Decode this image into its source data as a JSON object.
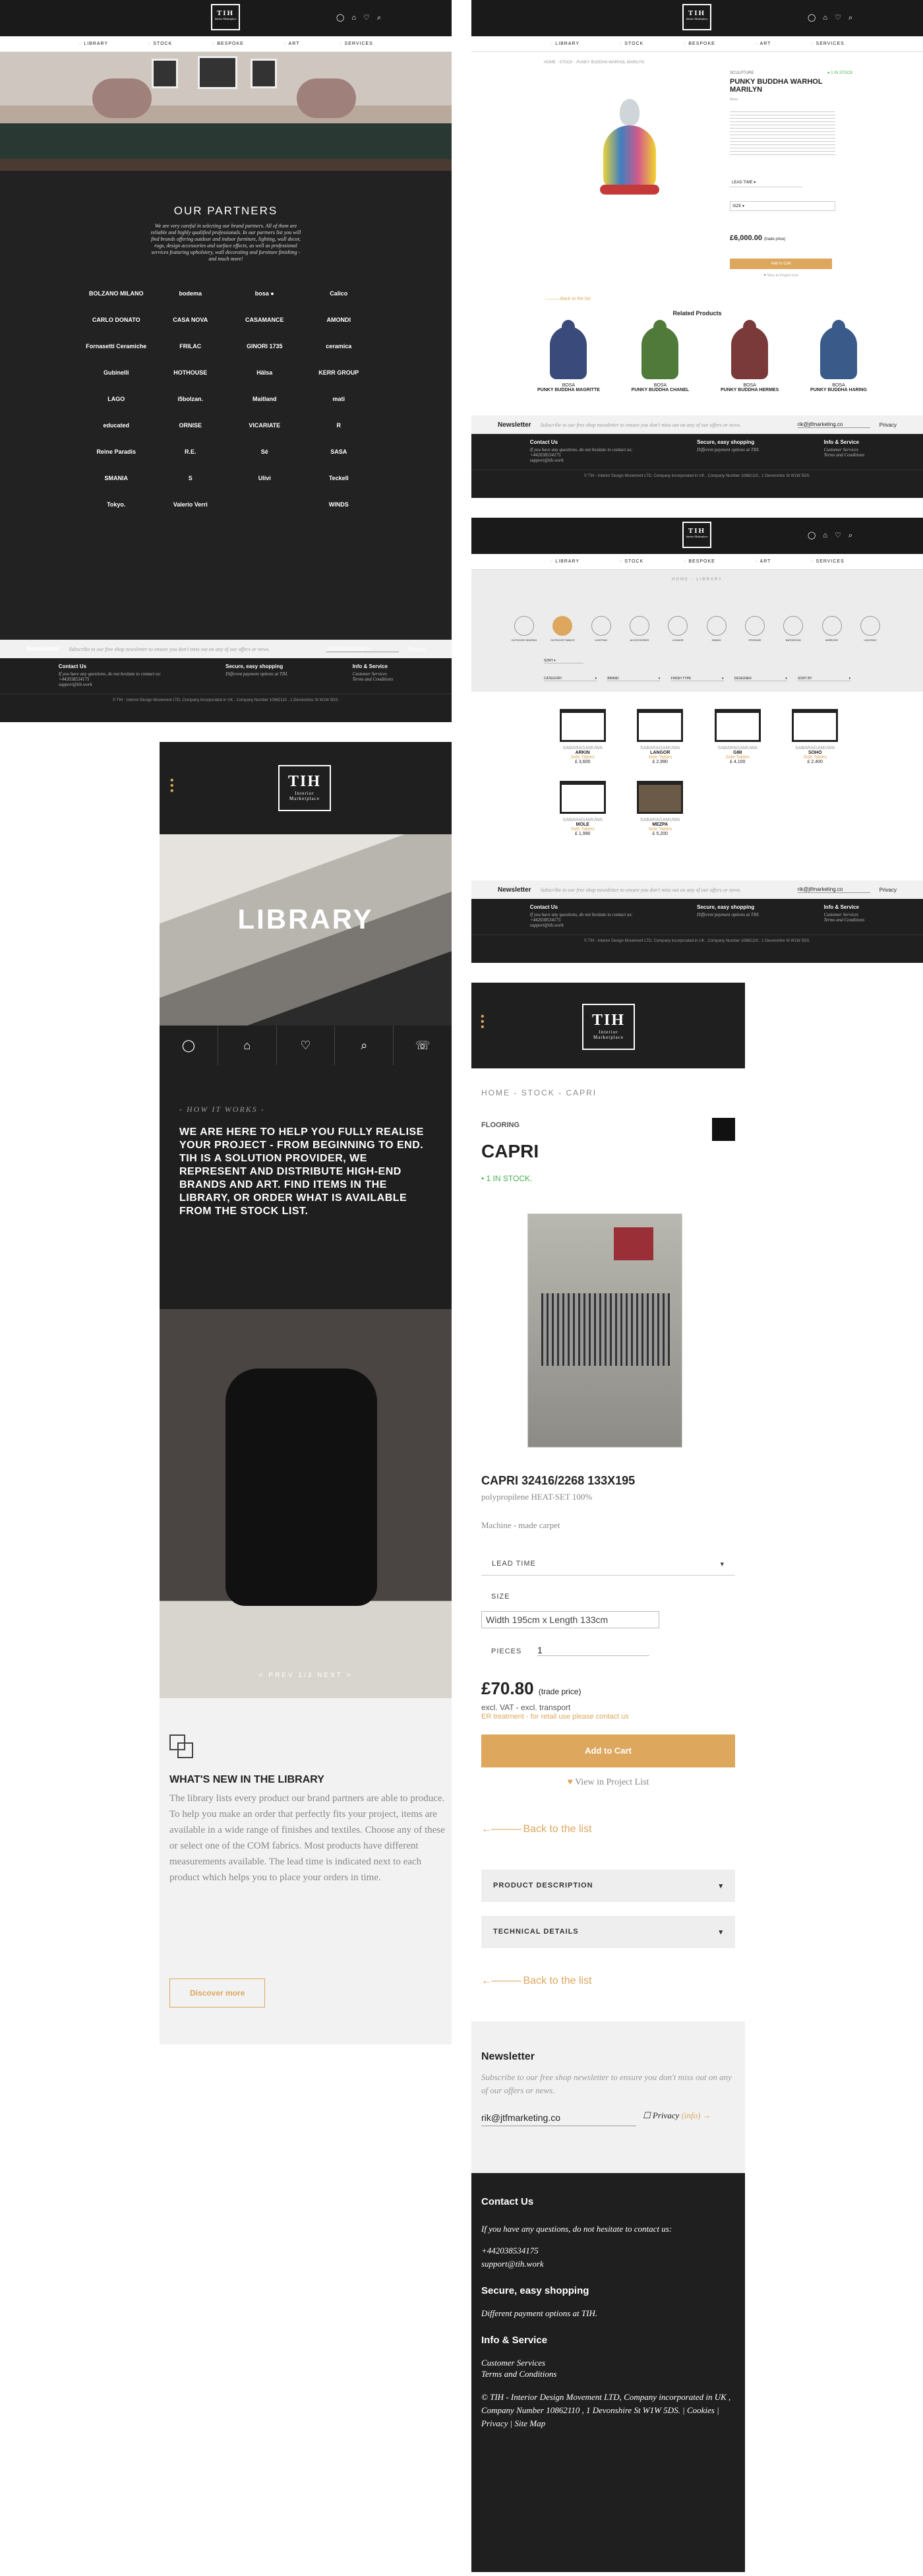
{
  "nav": {
    "library": "Library",
    "stock": "Stock",
    "bespoke": "Bespoke",
    "art": "Art",
    "services": "Services"
  },
  "logo": {
    "mark": "TIH",
    "sub": "Interior Marketplace"
  },
  "partners": {
    "title": "OUR PARTNERS",
    "intro": "We are very careful in selecting our brand partners. All of them are reliable and highly qualified professionals. In our partners list you will find brands offering outdoor and indoor furniture, lighting, wall decor, rugs, design accessories and surface effects, as well as professional services featuring upholstery, wall decorating and furniture finishing - and much more!",
    "brands": [
      "BOLZANO MILANO",
      "bodema",
      "bosa ●",
      "Calico",
      "CARLO DONATO",
      "CASA NOVA",
      "CASAMANCE",
      "AMONDI",
      "Fornasetti Ceramiche",
      "FRILAC",
      "GINORI 1735",
      "ceramica",
      "Gubinelli",
      "HOTHOUSE",
      "Hälsa",
      "KERR GROUP",
      "LAGO",
      "i5bolzan.",
      "Maitland",
      "mati",
      "educated",
      "ORNISE",
      "VICARIATE",
      "R",
      "Reine Paradis",
      "R.E.",
      "Sé",
      "SASA",
      "SMANIA",
      "S",
      "Ulivi",
      "Teckell",
      "Tokyo.",
      "Valerio Verri",
      "",
      "WINDS"
    ]
  },
  "newsletter": {
    "title": "Newsletter",
    "text": "Subscribe to our free shop newsletter to ensure you don't miss out on any of our offers or news.",
    "email": "rik@jtfmarketing.co",
    "privacy": "Privacy",
    "privacy_info": "(info)"
  },
  "footer": {
    "contact_title": "Contact Us",
    "contact_text": "If you have any questions, do not hesitate to contact us:",
    "phone": "+442038534175",
    "email": "support@tih.work",
    "secure_title": "Secure, easy shopping",
    "secure_text": "Different payment options at TIH.",
    "info_title": "Info & Service",
    "info_links": [
      "Customer Services",
      "Terms and Conditions"
    ],
    "copyright": "© TIH - Interior Design Movement LTD, Company incorporated in UK , Company Number 10862110 , 1 Devonshire St W1W 5DS.",
    "legal_links": [
      "Cookies",
      "Privacy",
      "Site Map"
    ]
  },
  "product": {
    "breadcrumb": "HOME - STOCK - PUNKY BUDDHA WARHOL MARILYN",
    "category": "SCULPTURE",
    "title": "PUNKY BUDDHA WARHOL MARILYN",
    "stock": "● 1 IN STOCK",
    "brand": "Bosa",
    "price": "£6,000.00",
    "price_note": "(trade price)",
    "cart": "Add to Cart",
    "wish": "♥ View in Project List",
    "back": "Back to the list",
    "related_title": "Related Products",
    "related": [
      {
        "brand": "BOSA",
        "name": "PUNKY BUDDHA MAGRITTE"
      },
      {
        "brand": "BOSA",
        "name": "PUNKY BUDDHA CHANEL"
      },
      {
        "brand": "BOSA",
        "name": "PUNKY BUDDHA HERMES"
      },
      {
        "brand": "BOSA",
        "name": "PUNKY BUDDHA HARING"
      }
    ]
  },
  "listing": {
    "breadcrumb": "HOME - LIBRARY",
    "categories": [
      "OUTDOOR SEATING",
      "OUTDOOR TABLES",
      "LIGHTING",
      "ACCESSORIES",
      "LOUNGE",
      "DINING",
      "STORAGE",
      "BATHROOM",
      "MIRRORS",
      "LIGHTING"
    ],
    "filters": [
      "CATEGORY",
      "BRAND",
      "FINISH TYPE",
      "DESIGNER",
      "SORT BY"
    ],
    "items": [
      {
        "brand": "SABARAGAMUWA",
        "name": "ARKIN",
        "type": "Side Tables",
        "price": "£ 3,600"
      },
      {
        "brand": "SABARAGAMUWA",
        "name": "LANGOR",
        "type": "Side Tables",
        "price": "£ 2,990"
      },
      {
        "brand": "SABARAGAMUWA",
        "name": "GIM",
        "type": "Side Tables",
        "price": "£ 4,100"
      },
      {
        "brand": "SABARAGAMUWA",
        "name": "SOHO",
        "type": "Side Tables",
        "price": "£ 2,400"
      },
      {
        "brand": "SABARAGAMUWA",
        "name": "MOLE",
        "type": "Side Tables",
        "price": "£ 1,990"
      },
      {
        "brand": "SABARAGAMUWA",
        "name": "MEZPA",
        "type": "Side Tables",
        "price": "£ 5,200"
      }
    ]
  },
  "mobile_library": {
    "hero": "LIBRARY",
    "how": "- HOW IT WORKS -",
    "how_text": "WE ARE HERE TO HELP YOU FULLY REALISE YOUR PROJECT - FROM BEGINNING TO END. TIH IS A SOLUTION PROVIDER, WE REPRESENT AND DISTRIBUTE HIGH-END BRANDS AND ART. FIND ITEMS IN THE LIBRARY, OR ORDER WHAT IS AVAILABLE FROM THE STOCK LIST.",
    "slider": "< PREV  1/3  NEXT >",
    "new_title": "WHAT'S NEW IN THE LIBRARY",
    "new_text": "The library lists every product our brand partners are able to produce. To help you make an order that perfectly fits your project, items are available in a wide range of finishes and textiles. Choose any of these or select one of the COM fabrics. Most products have different measurements available. The lead time is indicated next to each product which helps you to place your orders in time.",
    "discover": "Discover more"
  },
  "mobile_product": {
    "breadcrumb": "HOME - STOCK - CAPRI",
    "category": "FLOORING",
    "title": "CAPRI",
    "stock": "• 1 IN STOCK.",
    "code": "CAPRI 32416/2268 133X195",
    "material": "polypropilene HEAT-SET 100%",
    "subtitle": "Machine - made carpet",
    "lead": "LEAD TIME",
    "size_label": "SIZE",
    "size": "Width 195cm x Length 133cm",
    "pieces_label": "PIECES",
    "pieces": "1",
    "price": "£70.80",
    "price_note": "(trade price)",
    "vat": "excl. VAT - excl. transport",
    "retail": "ER treatment - for retail use please contact us",
    "cart": "Add to Cart",
    "project": "View in Project List",
    "back": "Back to the list",
    "desc": "PRODUCT DESCRIPTION",
    "tech": "TECHNICAL DETAILS"
  }
}
